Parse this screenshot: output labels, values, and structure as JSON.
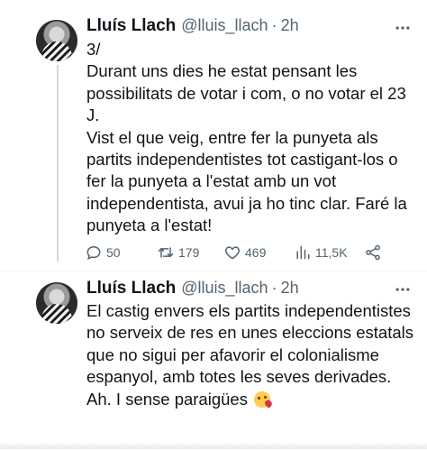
{
  "tweets": [
    {
      "author_name": "Lluís Llach",
      "handle": "@lluis_llach",
      "separator": "·",
      "time": "2h",
      "text": "3/\nDurant uns dies he estat pensant les possibilitats de votar i com, o no votar el 23 J.\nVist el que veig, entre fer la punyeta als partits independentistes tot castigant-los o fer la punyeta a l'estat amb un vot independentista, avui ja ho tinc clar. Faré la punyeta a l'estat!",
      "stats": {
        "replies": "50",
        "retweets": "179",
        "likes": "469",
        "views": "11,5K"
      },
      "icons": [
        "reply-icon",
        "retweet-icon",
        "like-icon",
        "views-icon",
        "share-icon"
      ]
    },
    {
      "author_name": "Lluís Llach",
      "handle": "@lluis_llach",
      "separator": "·",
      "time": "2h",
      "text": "El castig envers els partits independentistes no serveix de res en unes eleccions estatals que no sigui per afavorir el colonialisme espanyol, amb totes les seves derivades.\nAh. I sense paraigües",
      "emoji": "face-blowing-kiss"
    }
  ],
  "colors": {
    "text": "#0f1419",
    "secondary": "#536471",
    "thread_line": "#cfd9de"
  }
}
